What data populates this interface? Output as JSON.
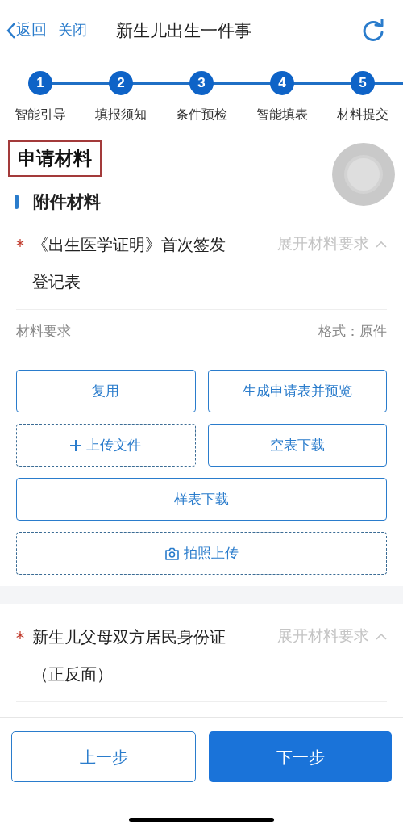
{
  "header": {
    "back": "返回",
    "close": "关闭",
    "title": "新生儿出生一件事"
  },
  "steps": [
    {
      "number": "1",
      "label": "智能引导"
    },
    {
      "number": "2",
      "label": "填报须知"
    },
    {
      "number": "3",
      "label": "条件预检"
    },
    {
      "number": "4",
      "label": "智能填表"
    },
    {
      "number": "5",
      "label": "材料提交"
    }
  ],
  "section_title": "申请材料",
  "subsection": "附件材料",
  "materials": [
    {
      "required": true,
      "name_lines": [
        "《出生医学证明》首次签发",
        "登记表"
      ],
      "toggle": "展开材料要求",
      "requirement_label": "材料要求",
      "format": "格式：原件",
      "buttons": [
        {
          "label": "复用",
          "kind": "outline",
          "wide": false
        },
        {
          "label": "生成申请表并预览",
          "kind": "outline",
          "wide": false
        },
        {
          "label": "上传文件",
          "kind": "upload",
          "wide": false
        },
        {
          "label": "空表下载",
          "kind": "outline",
          "wide": false
        },
        {
          "label": "样表下载",
          "kind": "outline",
          "wide": true
        },
        {
          "label": "拍照上传",
          "kind": "photo",
          "wide": true
        }
      ]
    },
    {
      "required": true,
      "name_lines": [
        "新生儿父母双方居民身份证",
        "（正反面）"
      ],
      "toggle": "展开材料要求"
    }
  ],
  "footer": [
    {
      "label": "上一步",
      "kind": "secondary"
    },
    {
      "label": "下一步",
      "kind": "primary"
    }
  ]
}
